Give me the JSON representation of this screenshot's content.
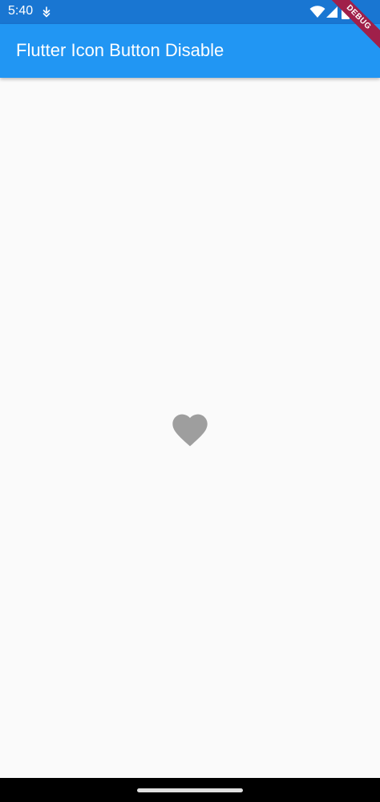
{
  "status_bar": {
    "time": "5:40",
    "icons": [
      "download-arrow-icon",
      "wifi-icon",
      "signal-icon",
      "battery-icon"
    ]
  },
  "app_bar": {
    "title": "Flutter Icon Button Disable"
  },
  "debug_banner": {
    "label": "DEBUG"
  },
  "body": {
    "icon_button": {
      "icon": "favorite-heart-icon",
      "state": "disabled",
      "color": "#9e9e9e"
    }
  },
  "colors": {
    "status_bar": "#1976d2",
    "app_bar": "#2196f3",
    "background": "#fafafa",
    "debug_banner": "#a0204a"
  }
}
